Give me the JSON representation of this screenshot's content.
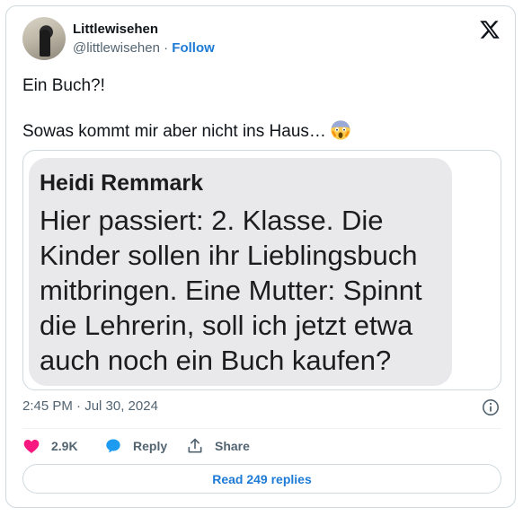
{
  "author": {
    "name": "Littlewisehen",
    "handle": "@littlewisehen",
    "separator": "·",
    "follow_label": "Follow"
  },
  "tweet": {
    "line1": "Ein Buch?!",
    "line2": "Sowas kommt mir aber nicht ins Haus…",
    "emoji": "face-screaming-in-fear-emoji"
  },
  "media": {
    "bubble_author": "Heidi Remmark",
    "bubble_text": "Hier passiert: 2. Klasse. Die Kinder sollen ihr Lieblingsbuch mitbringen. Eine Mutter: Spinnt die Lehrerin, soll ich jetzt etwa auch noch ein Buch kaufen?"
  },
  "timestamp": "2:45 PM · Jul 30, 2024",
  "actions": {
    "like_count": "2.9K",
    "reply_label": "Reply",
    "share_label": "Share"
  },
  "read_replies_label": "Read 249 replies",
  "colors": {
    "like": "#f91880",
    "reply": "#1d9bf0",
    "link": "#1d7bd6",
    "muted": "#536471"
  }
}
